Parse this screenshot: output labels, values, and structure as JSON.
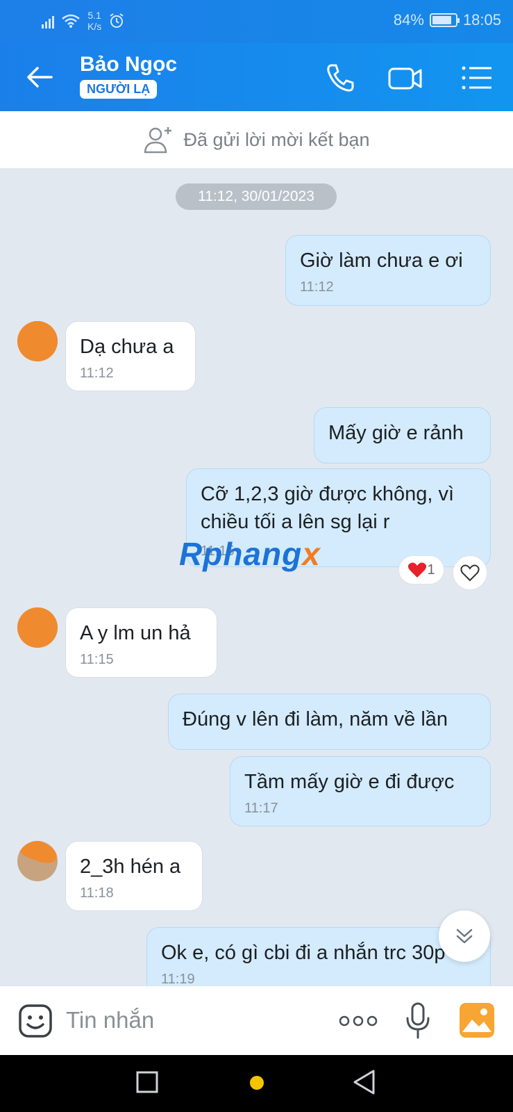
{
  "status_bar": {
    "net_speed_value": "5.1",
    "net_speed_unit": "K/s",
    "battery_percent": "84%",
    "battery_level": 0.84,
    "time": "18:05"
  },
  "header": {
    "contact_name": "Bảo Ngọc",
    "badge": "NGƯỜI LẠ",
    "icons": [
      "back-arrow-icon",
      "phone-icon",
      "video-camera-icon",
      "menu-list-icon"
    ]
  },
  "friend_request": {
    "text": "Đã gửi lời mời kết bạn",
    "icon": "add-friend-icon"
  },
  "chat": {
    "date_separator": "11:12, 30/01/2023",
    "messages": [
      {
        "side": "out",
        "text": "Giờ làm chưa e ơi",
        "time": "11:12"
      },
      {
        "side": "in",
        "text": "Dạ chưa a",
        "time": "11:12"
      },
      {
        "side": "out",
        "text": "Mấy giờ e rảnh",
        "time": ""
      },
      {
        "side": "out",
        "text": "Cỡ 1,2,3 giờ được không, vì chiều tối a lên sg lại r",
        "time": "11:15"
      },
      {
        "side": "in",
        "text": "A y lm un hả",
        "time": "11:15"
      },
      {
        "side": "out",
        "text": "Đúng v lên đi làm, năm về lần",
        "time": ""
      },
      {
        "side": "out",
        "text": "Tầm mấy giờ e đi được",
        "time": "11:17"
      },
      {
        "side": "in",
        "text": "2_3h hén a",
        "time": "11:18"
      },
      {
        "side": "out",
        "text": "Ok e, có gì cbi đi a nhắn trc 30p",
        "time": "11:19"
      }
    ],
    "reaction": {
      "emoji": "heart",
      "count": "1"
    },
    "watermark_part1": "Rphang",
    "watermark_part2": "x"
  },
  "input_bar": {
    "placeholder": "Tin nhắn",
    "icons": [
      "emoji-sticker-icon",
      "more-dots-icon",
      "microphone-icon",
      "gallery-image-icon"
    ]
  },
  "colors": {
    "header_blue": "#1b7fe9",
    "outgoing_bubble": "#d3ebfc",
    "incoming_bubble": "#ffffff",
    "chat_background": "#e2e8ef",
    "badge_text": "#1a77de"
  }
}
